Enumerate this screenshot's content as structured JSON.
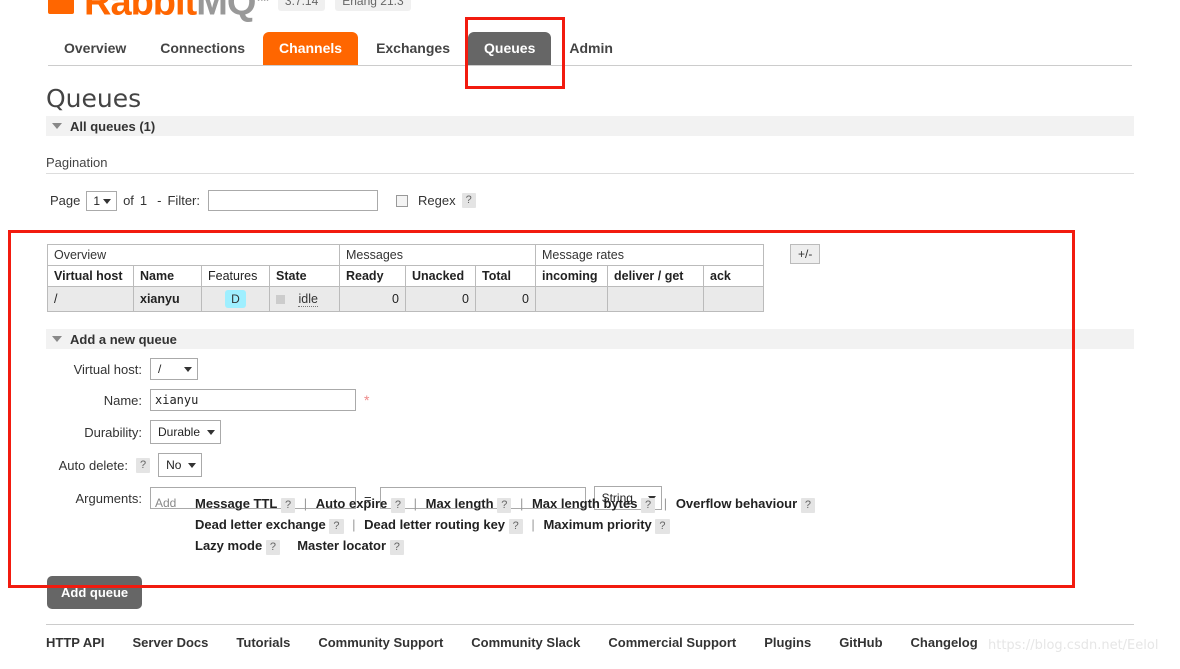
{
  "brand": {
    "name_rabbit": "Rabbit",
    "name_mq": "MQ",
    "tm": "TM",
    "version": "3.7.14",
    "erlang": "Erlang 21.3",
    "accent_color": "#ff6600",
    "current_tab_color": "#666666"
  },
  "tabs": [
    {
      "label": "Overview",
      "state": "normal"
    },
    {
      "label": "Connections",
      "state": "normal"
    },
    {
      "label": "Channels",
      "state": "active"
    },
    {
      "label": "Exchanges",
      "state": "normal"
    },
    {
      "label": "Queues",
      "state": "current"
    },
    {
      "label": "Admin",
      "state": "normal"
    }
  ],
  "page": {
    "title": "Queues",
    "all_queues_header": "All queues (1)"
  },
  "pagination": {
    "legend": "Pagination",
    "page_label": "Page",
    "page_value": "1",
    "of_label": "of",
    "total_pages": "1",
    "dash": "-",
    "filter_label": "Filter:",
    "filter_value": "",
    "regex_label": "Regex",
    "help": "?"
  },
  "table": {
    "group_headers": {
      "overview": "Overview",
      "messages": "Messages",
      "message_rates": "Message rates"
    },
    "toggle_columns": "+/-",
    "columns": [
      {
        "label": "Virtual host",
        "sortable": true
      },
      {
        "label": "Name",
        "sortable": true
      },
      {
        "label": "Features",
        "sortable": false
      },
      {
        "label": "State",
        "sortable": true
      },
      {
        "label": "Ready",
        "sortable": true
      },
      {
        "label": "Unacked",
        "sortable": true
      },
      {
        "label": "Total",
        "sortable": true
      },
      {
        "label": "incoming",
        "sortable": true
      },
      {
        "label": "deliver / get",
        "sortable": true
      },
      {
        "label": "ack",
        "sortable": true
      }
    ],
    "rows": [
      {
        "vhost": "/",
        "name": "xianyu",
        "features": "D",
        "state": "idle",
        "ready": "0",
        "unacked": "0",
        "total": "0",
        "incoming": "",
        "deliver_get": "",
        "ack": ""
      }
    ]
  },
  "add_queue": {
    "section_title": "Add a new queue",
    "fields": {
      "virtual_host_label": "Virtual host:",
      "virtual_host_value": "/",
      "name_label": "Name:",
      "name_value": "xianyu",
      "required_mark": "*",
      "durability_label": "Durability:",
      "durability_value": "Durable",
      "auto_delete_label": "Auto delete:",
      "auto_delete_help": "?",
      "auto_delete_value": "No",
      "arguments_label": "Arguments:",
      "argument_key": "",
      "argument_equals": "=",
      "argument_value": "",
      "argument_type": "String"
    },
    "add_word": "Add",
    "presets_line1": [
      {
        "label": "Message TTL",
        "help": "?"
      },
      {
        "label": "Auto expire",
        "help": "?"
      },
      {
        "label": "Max length",
        "help": "?"
      },
      {
        "label": "Max length bytes",
        "help": "?"
      },
      {
        "label": "Overflow behaviour",
        "help": "?"
      }
    ],
    "presets_line2": [
      {
        "label": "Dead letter exchange",
        "help": "?"
      },
      {
        "label": "Dead letter routing key",
        "help": "?"
      },
      {
        "label": "Maximum priority",
        "help": "?"
      }
    ],
    "presets_line3": [
      {
        "label": "Lazy mode",
        "help": "?"
      },
      {
        "label": "Master locator",
        "help": "?"
      }
    ],
    "submit_label": "Add queue"
  },
  "footer": {
    "links": [
      "HTTP API",
      "Server Docs",
      "Tutorials",
      "Community Support",
      "Community Slack",
      "Commercial Support",
      "Plugins",
      "GitHub",
      "Changelog"
    ]
  },
  "watermark": "https://blog.csdn.net/Eelol",
  "annotations": {
    "highlight_color": "#f21b0f"
  }
}
